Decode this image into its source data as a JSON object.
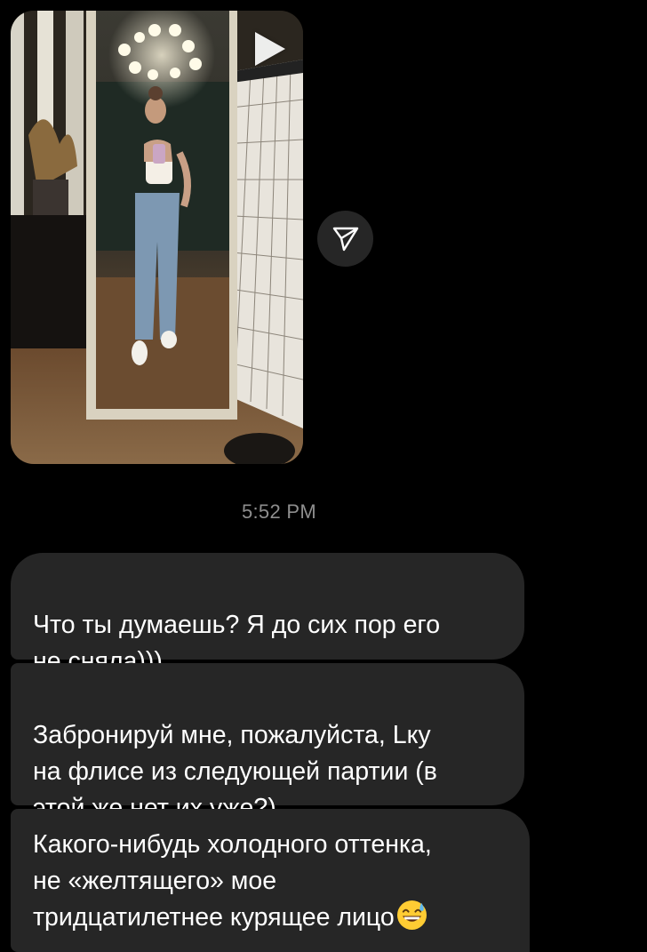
{
  "thread": {
    "timestamp": "5:52 PM",
    "story": {
      "type": "video",
      "play_icon": "play-icon"
    },
    "share_icon": "paper-plane-icon",
    "messages": [
      {
        "text": "Что ты думаешь? Я до сих пор его\nне сняла)))"
      },
      {
        "text": "Забронируй мне, пожалуйста, Lку\nна флисе из следующей партии (в\nэтой же нет их уже?)"
      },
      {
        "text": "Какого-нибудь холодного оттенка,\nне «желтящего» мое\nтридцатилетнее курящее лицо",
        "emoji": "sweat-smile-emoji"
      }
    ]
  },
  "colors": {
    "background": "#000000",
    "bubble": "#262626",
    "text": "#ffffff",
    "timestamp": "#8e8e8e"
  }
}
